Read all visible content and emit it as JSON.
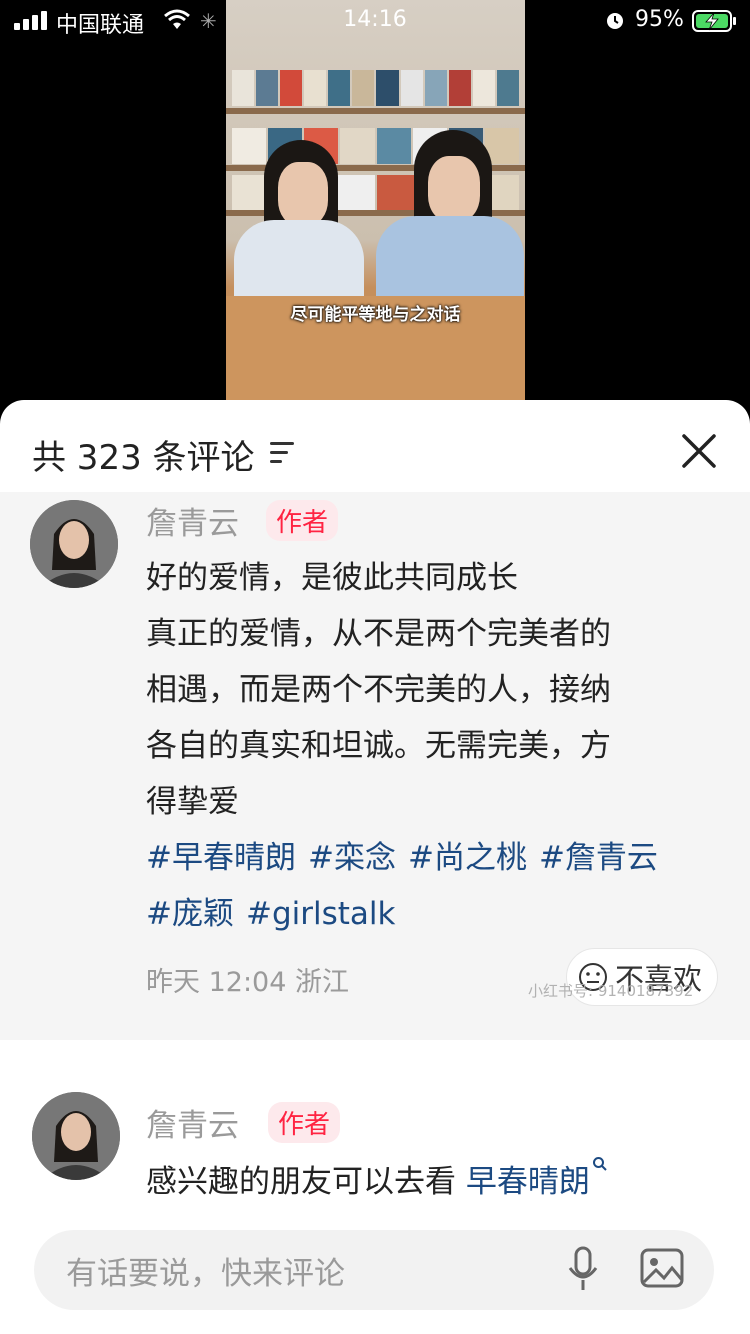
{
  "status_bar": {
    "carrier": "中国联通",
    "time": "14:16",
    "battery": "95%"
  },
  "video": {
    "subtitle": "尽可能平等地与之对话"
  },
  "comments_sheet": {
    "title": "共 323 条评论",
    "comments": [
      {
        "username": "詹青云",
        "badge": "作者",
        "lines": [
          "好的爱情，是彼此共同成长",
          "真正的爱情，从不是两个完美者的",
          "相遇，而是两个不完美的人，接纳",
          "各自的真实和坦诚。无需完美，方",
          "得挚爱"
        ],
        "tags": [
          "#早春晴朗",
          "#栾念",
          "#尚之桃",
          "#詹青云",
          "#庞颖",
          "#girlstalk"
        ],
        "meta": "昨天 12:04 浙江",
        "dislike_label": "不喜欢"
      },
      {
        "username": "詹青云",
        "badge": "作者",
        "text": "感兴趣的朋友可以去看 ",
        "link": "早春晴朗"
      }
    ],
    "input_placeholder": "有话要说，快来评论"
  },
  "watermark": "小红书号: 9140187392"
}
